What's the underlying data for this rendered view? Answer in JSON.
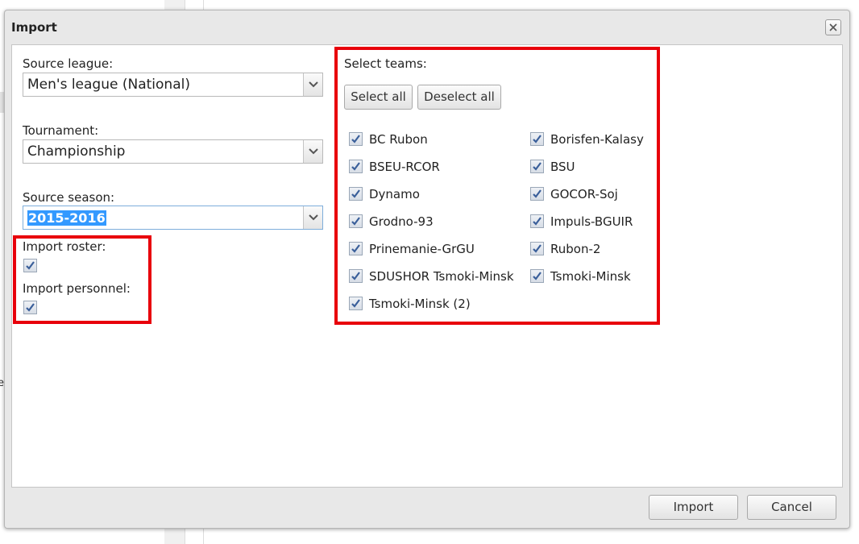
{
  "dialog": {
    "title": "Import",
    "source_league": {
      "label": "Source league:",
      "value": "Men's league (National)"
    },
    "tournament": {
      "label": "Tournament:",
      "value": "Championship"
    },
    "source_season": {
      "label": "Source season:",
      "value": "2015-2016"
    },
    "import_roster": {
      "label": "Import roster:",
      "checked": true
    },
    "import_personnel": {
      "label": "Import personnel:",
      "checked": true
    },
    "select_teams": {
      "label": "Select teams:",
      "select_all": "Select all",
      "deselect_all": "Deselect all",
      "teams": [
        {
          "name": "BC Rubon",
          "checked": true
        },
        {
          "name": "Borisfen-Kalasy",
          "checked": true
        },
        {
          "name": "BSEU-RCOR",
          "checked": true
        },
        {
          "name": "BSU",
          "checked": true
        },
        {
          "name": "Dynamo",
          "checked": true
        },
        {
          "name": "GOCOR-Soj",
          "checked": true
        },
        {
          "name": "Grodno-93",
          "checked": true
        },
        {
          "name": "Impuls-BGUIR",
          "checked": true
        },
        {
          "name": "Prinemanie-GrGU",
          "checked": true
        },
        {
          "name": "Rubon-2",
          "checked": true
        },
        {
          "name": "SDUSHOR Tsmoki-Minsk",
          "checked": true
        },
        {
          "name": "Tsmoki-Minsk",
          "checked": true
        },
        {
          "name": "Tsmoki-Minsk (2)",
          "checked": true
        }
      ]
    },
    "footer": {
      "import_button": "Import",
      "cancel_button": "Cancel"
    }
  },
  "background": {
    "edge_text": "e"
  },
  "colors": {
    "highlight_box": "#e8000b",
    "selection": "#3399ff",
    "check": "#3a5f9a"
  }
}
